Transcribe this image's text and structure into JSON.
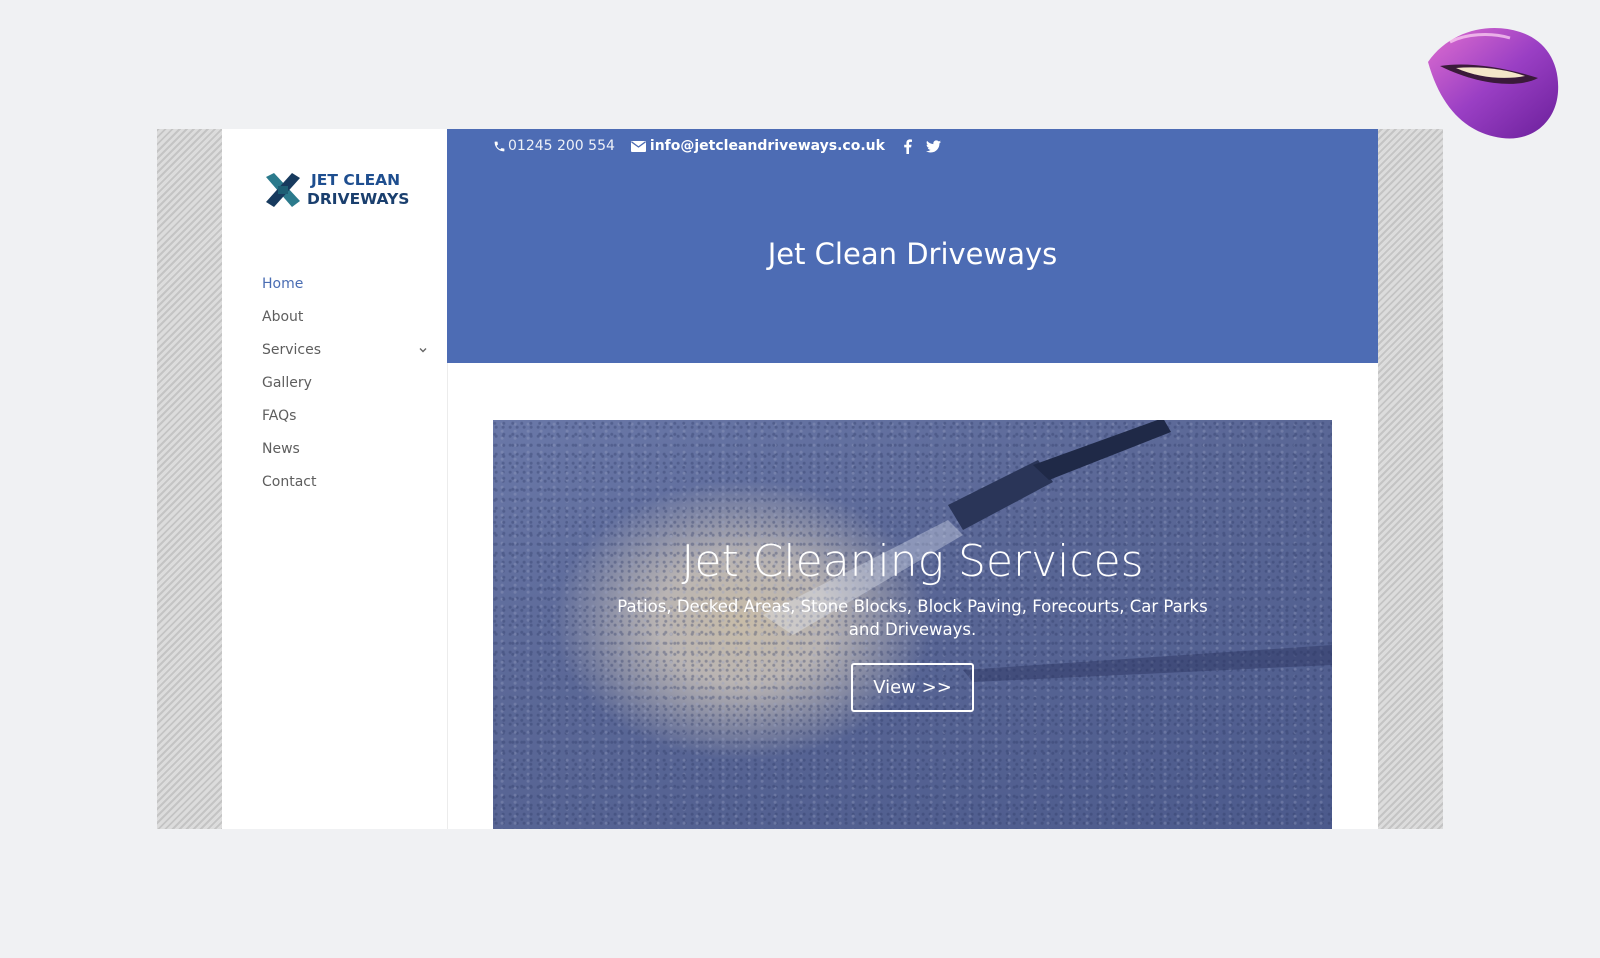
{
  "brand": {
    "logo_line1": "JET CLEAN",
    "logo_line2": "DRIVEWAYS",
    "logo_icon": "crossed-x-logo-icon"
  },
  "nav": {
    "items": [
      {
        "label": "Home",
        "active": true
      },
      {
        "label": "About"
      },
      {
        "label": "Services",
        "has_submenu": true
      },
      {
        "label": "Gallery"
      },
      {
        "label": "FAQs"
      },
      {
        "label": "News"
      },
      {
        "label": "Contact"
      }
    ]
  },
  "topbar": {
    "phone": "01245 200 554",
    "email": "info@jetcleandriveways.co.uk",
    "social_icons": [
      "facebook-icon",
      "twitter-icon"
    ]
  },
  "header": {
    "title": "Jet Clean Driveways"
  },
  "hero": {
    "heading": "Jet Cleaning Services",
    "subtext": "Patios, Decked Areas, Stone Blocks, Block Paving, Forecourts, Car Parks and Driveways.",
    "button_label": "View >>"
  },
  "colors": {
    "header_blue": "#4d6cb4",
    "nav_active": "#4a6db3",
    "nav_text": "#5e5e5e",
    "page_bg": "#f0f1f3"
  }
}
